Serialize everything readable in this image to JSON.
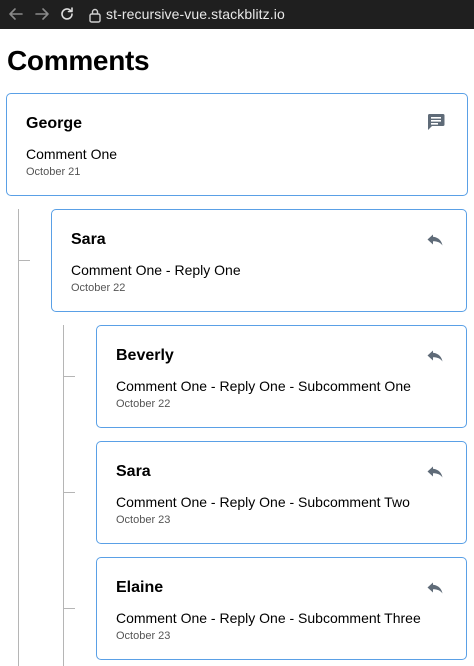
{
  "browser": {
    "url": "st-recursive-vue.stackblitz.io",
    "icons": [
      "arrow-left-icon",
      "arrow-right-icon",
      "reload-icon",
      "lock-icon"
    ]
  },
  "page": {
    "title": "Comments"
  },
  "comments": [
    {
      "author": "George",
      "body": "Comment One",
      "date": "October 21",
      "icon": "comment-icon"
    },
    {
      "author": "Sara",
      "body": "Comment One - Reply One",
      "date": "October 22",
      "icon": "reply-icon"
    },
    {
      "author": "Beverly",
      "body": "Comment One - Reply One - Subcomment One",
      "date": "October 22",
      "icon": "reply-icon"
    },
    {
      "author": "Sara",
      "body": "Comment One - Reply One - Subcomment Two",
      "date": "October 23",
      "icon": "reply-icon"
    },
    {
      "author": "Elaine",
      "body": "Comment One - Reply One - Subcomment Three",
      "date": "October 23",
      "icon": "reply-icon"
    }
  ],
  "colors": {
    "card_border": "#5aa0e6",
    "icon": "#5f6b78",
    "thread_line": "#b5b5b5",
    "browser_bar": "#1f1f1f"
  }
}
